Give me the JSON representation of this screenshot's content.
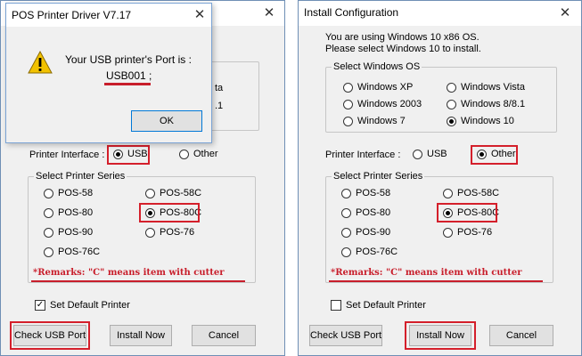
{
  "left_window": {
    "close_glyph": "✕",
    "printer_interface": {
      "label": "Printer Interface :",
      "usb": "USB",
      "other": "Other"
    },
    "series": {
      "title": "Select Printer Series",
      "items": [
        "POS-58",
        "POS-58C",
        "POS-80",
        "POS-80C",
        "POS-90",
        "POS-76",
        "POS-76C"
      ]
    },
    "os_partial": [
      "ta",
      ".1"
    ],
    "remark": "*Remarks: \"C\" means item with cutter",
    "set_default": "Set Default Printer",
    "buttons": {
      "check_usb": "Check USB Port",
      "install": "Install Now",
      "cancel": "Cancel"
    }
  },
  "dialog": {
    "title": "POS Printer Driver V7.17",
    "close_glyph": "✕",
    "message": "Your USB printer's Port is :",
    "port": "USB001 ;",
    "ok": "OK"
  },
  "right_window": {
    "title": "Install Configuration",
    "close_glyph": "✕",
    "info_line1": "You are using Windows 10 x86 OS.",
    "info_line2": "Please select Windows 10 to install.",
    "os": {
      "title": "Select Windows OS",
      "items": [
        "Windows XP",
        "Windows Vista",
        "Windows 2003",
        "Windows 8/8.1",
        "Windows 7",
        "Windows 10"
      ]
    },
    "printer_interface": {
      "label": "Printer Interface :",
      "usb": "USB",
      "other": "Other"
    },
    "series": {
      "title": "Select Printer Series",
      "items": [
        "POS-58",
        "POS-58C",
        "POS-80",
        "POS-80C",
        "POS-90",
        "POS-76",
        "POS-76C"
      ]
    },
    "remark": "*Remarks: \"C\" means item with cutter",
    "set_default": "Set Default Printer",
    "buttons": {
      "check_usb": "Check USB Port",
      "install": "Install Now",
      "cancel": "Cancel"
    }
  },
  "colors": {
    "highlight": "#d41f2b",
    "remark": "#c81e2b",
    "warning": "#f2c200"
  }
}
